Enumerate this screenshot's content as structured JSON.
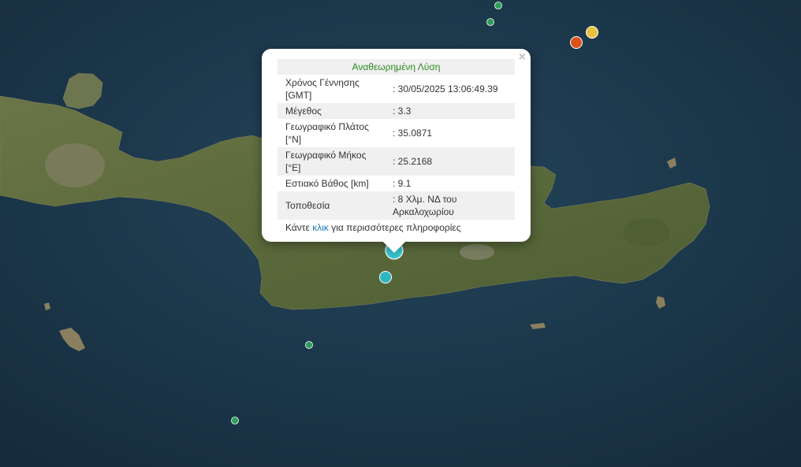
{
  "popup": {
    "title": "Αναθεωρημένη Λύση",
    "rows": [
      {
        "label": "Χρόνος Γέννησης [GMT]",
        "value": ": 30/05/2025 13:06:49.39"
      },
      {
        "label": "Μέγεθος",
        "value": ": 3.3"
      },
      {
        "label": "Γεωγραφικό Πλάτος [°N]",
        "value": ": 35.0871"
      },
      {
        "label": "Γεωγραφικό Μήκος [°E]",
        "value": ": 25.2168"
      },
      {
        "label": "Εστιακό Βάθος [km]",
        "value": ": 9.1"
      },
      {
        "label": "Τοποθεσία",
        "value": ": 8 Χλμ. ΝΔ του Αρκαλοχωρίου"
      }
    ],
    "more_prefix": "Κάντε ",
    "more_link": "κλικ",
    "more_suffix": " για περισσότερες πληροφορίες",
    "close_symbol": "×"
  },
  "colors": {
    "sea": "#1d3a4f",
    "land": "#5e6b3c",
    "marker_selected": "#3ac6cf",
    "marker_recent": "#2fb5c2",
    "marker_green": "#2e9e5b",
    "marker_orange": "#d9541c",
    "marker_yellow": "#e8c040",
    "title_green": "#2a8a1e",
    "link_blue": "#1a7ab8"
  }
}
